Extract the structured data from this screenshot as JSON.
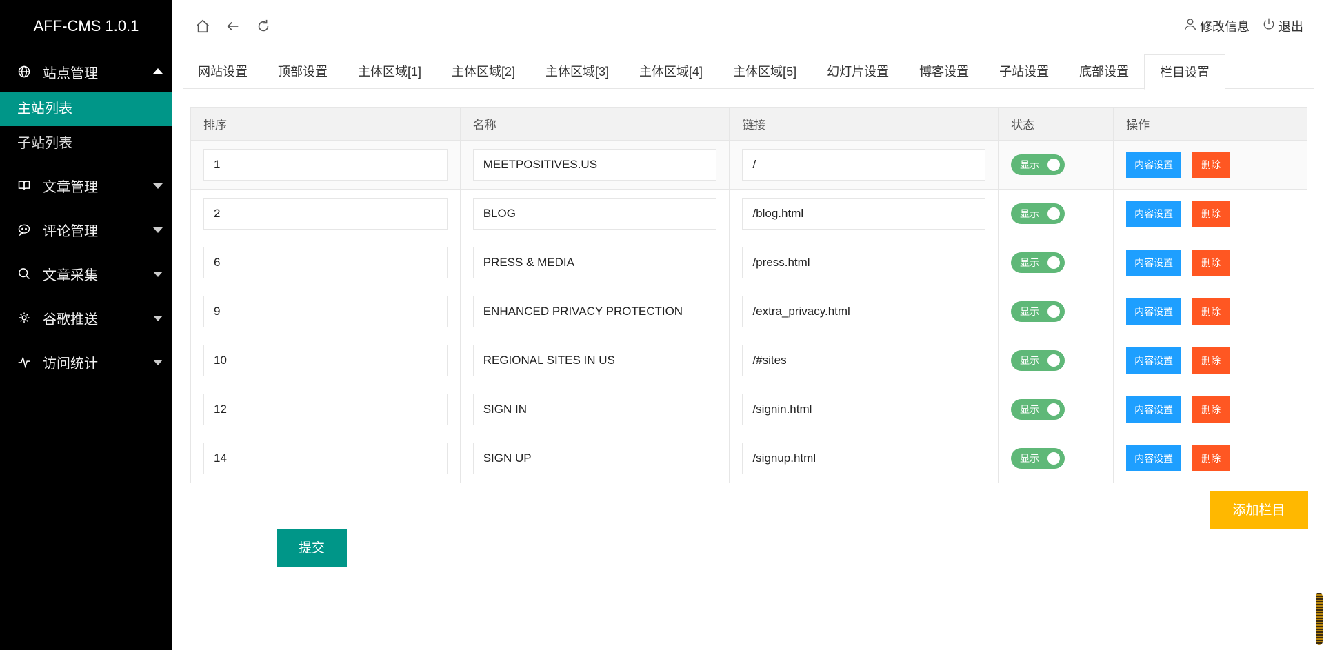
{
  "app": {
    "title": "AFF-CMS 1.0.1"
  },
  "sidebar": {
    "site_mgmt": "站点管理",
    "main_list": "主站列表",
    "sub_list": "子站列表",
    "articles": "文章管理",
    "comments": "评论管理",
    "collect": "文章采集",
    "google_push": "谷歌推送",
    "stats": "访问统计"
  },
  "header": {
    "edit_info": "修改信息",
    "logout": "退出"
  },
  "tabs": [
    "网站设置",
    "顶部设置",
    "主体区域[1]",
    "主体区域[2]",
    "主体区域[3]",
    "主体区域[4]",
    "主体区域[5]",
    "幻灯片设置",
    "博客设置",
    "子站设置",
    "底部设置",
    "栏目设置"
  ],
  "table": {
    "headers": {
      "order": "排序",
      "name": "名称",
      "link": "链接",
      "status": "状态",
      "ops": "操作"
    },
    "rows": [
      {
        "order": "1",
        "name": "MEETPOSITIVES.US",
        "link": "/",
        "status": "显示"
      },
      {
        "order": "2",
        "name": "BLOG",
        "link": "/blog.html",
        "status": "显示"
      },
      {
        "order": "6",
        "name": "PRESS & MEDIA",
        "link": "/press.html",
        "status": "显示"
      },
      {
        "order": "9",
        "name": "ENHANCED PRIVACY PROTECTION",
        "link": "/extra_privacy.html",
        "status": "显示"
      },
      {
        "order": "10",
        "name": "REGIONAL SITES IN US",
        "link": "/#sites",
        "status": "显示"
      },
      {
        "order": "12",
        "name": "SIGN IN",
        "link": "/signin.html",
        "status": "显示"
      },
      {
        "order": "14",
        "name": "SIGN UP",
        "link": "/signup.html",
        "status": "显示"
      }
    ],
    "content_btn": "内容设置",
    "delete_btn": "删除"
  },
  "actions": {
    "add": "添加栏目",
    "submit": "提交"
  },
  "colors": {
    "sidebar_bg": "#000000",
    "active_green": "#009688",
    "switch_green": "#5fb878",
    "blue": "#1e9fff",
    "red": "#ff5722",
    "yellow": "#ffb800"
  }
}
